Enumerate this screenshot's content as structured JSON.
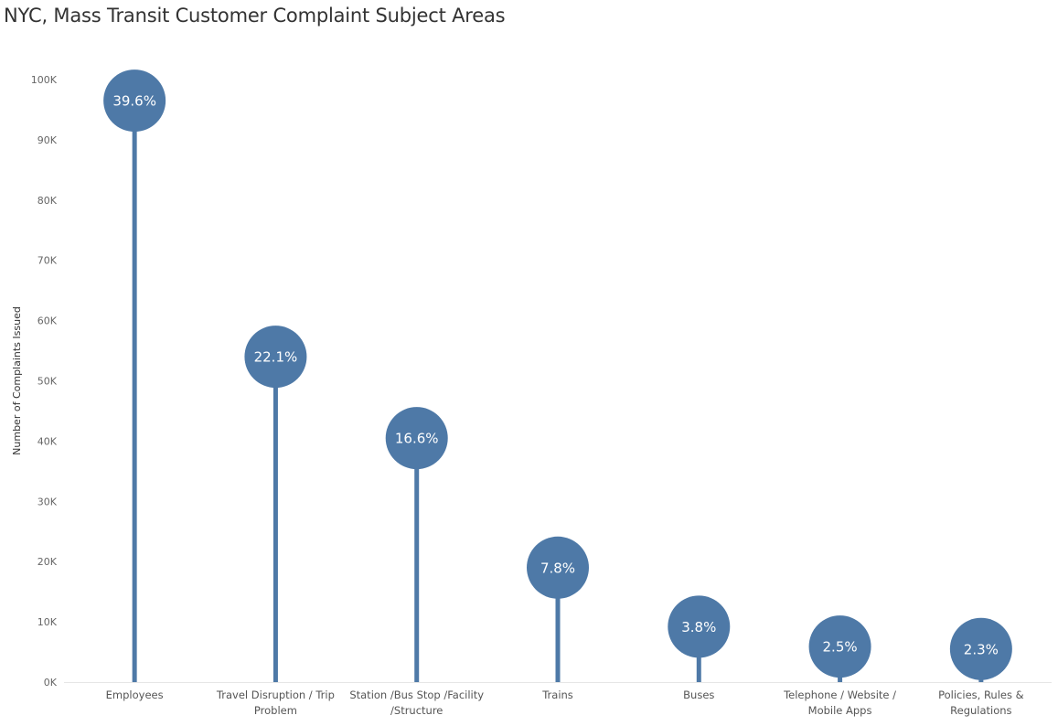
{
  "chart_data": {
    "type": "lollipop",
    "title": "NYC, Mass Transit Customer Complaint Subject Areas",
    "xlabel": "",
    "ylabel": "Number of Complaints Issued",
    "ylim": [
      0,
      100000
    ],
    "y_ticks": [
      0,
      10000,
      20000,
      30000,
      40000,
      50000,
      60000,
      70000,
      80000,
      90000,
      100000
    ],
    "y_tick_labels": [
      "0K",
      "10K",
      "20K",
      "30K",
      "40K",
      "50K",
      "60K",
      "70K",
      "80K",
      "90K",
      "100K"
    ],
    "grid": false,
    "color": "#4e79a7",
    "categories": [
      [
        "Employees"
      ],
      [
        "Travel Disruption / Trip",
        "Problem"
      ],
      [
        "Station /Bus Stop /Facility",
        "/Structure"
      ],
      [
        "Trains"
      ],
      [
        "Buses"
      ],
      [
        "Telephone / Website /",
        "Mobile Apps"
      ],
      [
        "Policies, Rules &",
        "Regulations"
      ]
    ],
    "values": [
      96500,
      54000,
      40500,
      19000,
      9200,
      5900,
      5500
    ],
    "labels": [
      "39.6%",
      "22.1%",
      "16.6%",
      "7.8%",
      "3.8%",
      "2.5%",
      "2.3%"
    ]
  }
}
